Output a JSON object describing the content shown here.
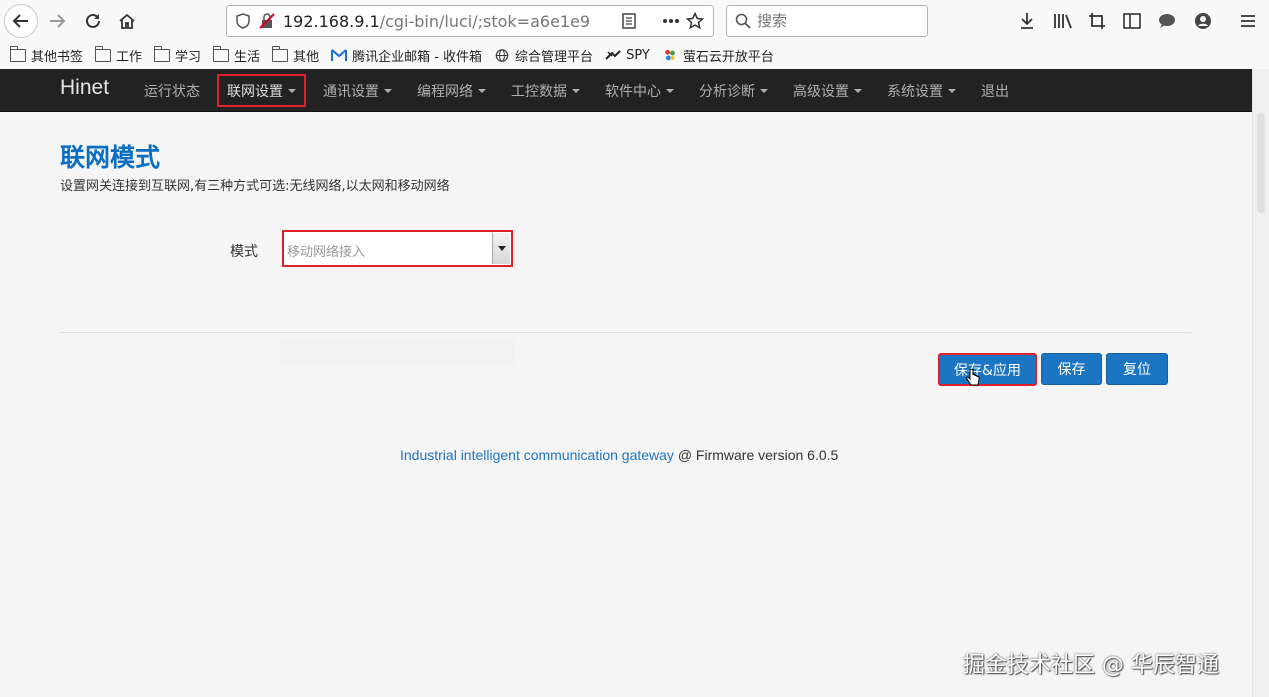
{
  "browser": {
    "url_main": "192.168.9.1",
    "url_rest": "/cgi-bin/luci/;stok=a6e1e9",
    "search_placeholder": "搜索"
  },
  "bookmarks": [
    {
      "label": "其他书签",
      "icon": "folder-icon"
    },
    {
      "label": "工作",
      "icon": "folder-icon"
    },
    {
      "label": "学习",
      "icon": "folder-icon"
    },
    {
      "label": "生活",
      "icon": "folder-icon"
    },
    {
      "label": "其他",
      "icon": "folder-icon"
    },
    {
      "label": "腾讯企业邮箱 - 收件箱",
      "icon": "mail-logo-icon"
    },
    {
      "label": "综合管理平台",
      "icon": "globe-icon"
    },
    {
      "label": "SPY",
      "icon": "spy-icon"
    },
    {
      "label": "萤石云开放平台",
      "icon": "ezviz-icon"
    }
  ],
  "app": {
    "brand": "Hinet",
    "menu": [
      {
        "label": "运行状态",
        "dropdown": false
      },
      {
        "label": "联网设置",
        "dropdown": true,
        "active": true
      },
      {
        "label": "通讯设置",
        "dropdown": true
      },
      {
        "label": "编程网络",
        "dropdown": true
      },
      {
        "label": "工控数据",
        "dropdown": true
      },
      {
        "label": "软件中心",
        "dropdown": true
      },
      {
        "label": "分析诊断",
        "dropdown": true
      },
      {
        "label": "高级设置",
        "dropdown": true
      },
      {
        "label": "系统设置",
        "dropdown": true
      },
      {
        "label": "退出",
        "dropdown": false
      }
    ]
  },
  "main": {
    "title": "联网模式",
    "description": "设置网关连接到互联网,有三种方式可选:无线网络,以太网和移动网络",
    "mode_label": "模式",
    "mode_value": "移动网络接入"
  },
  "actions": {
    "save_apply": "保存&应用",
    "save": "保存",
    "reset": "复位"
  },
  "footer": {
    "link_text": "Industrial intelligent communication gateway",
    "version_text": " @ Firmware version 6.0.5"
  },
  "watermark": "掘金技术社区 @ 华辰智通",
  "colors": {
    "accent": "#1b75c2",
    "title": "#0a6fc2",
    "highlight": "#e0202a",
    "navbar": "#222222"
  }
}
